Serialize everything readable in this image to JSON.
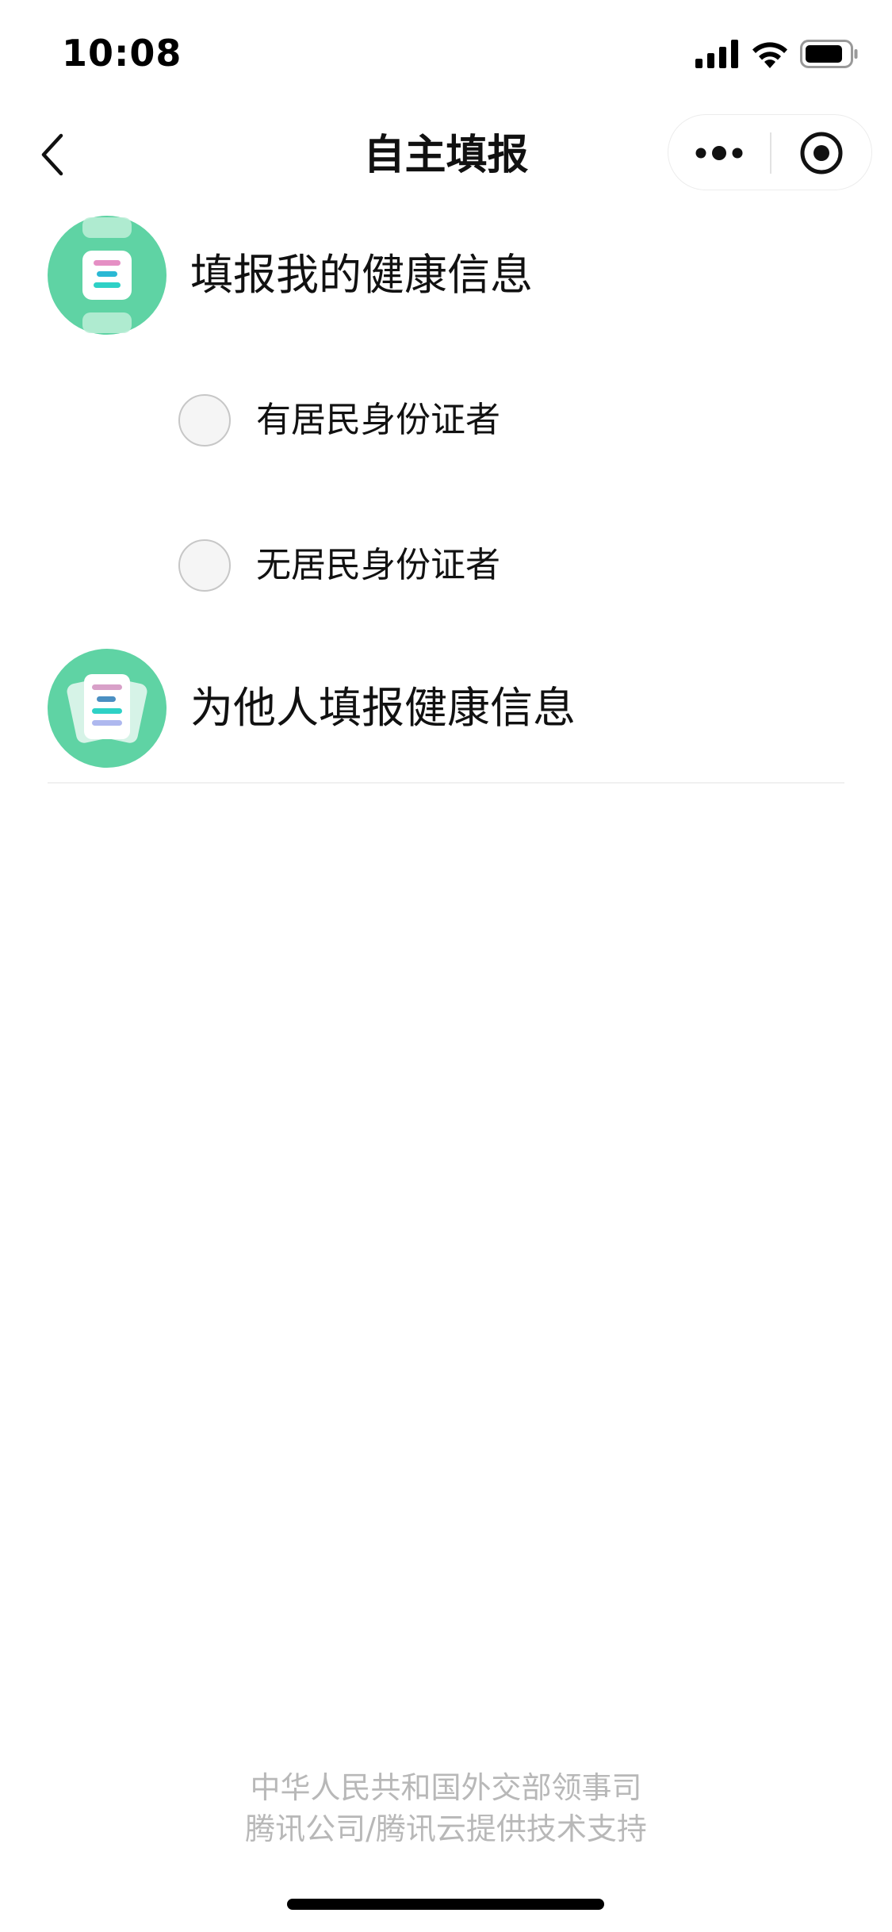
{
  "status_bar": {
    "time": "10:08",
    "icons": [
      "signal-icon",
      "wifi-icon",
      "battery-icon"
    ]
  },
  "nav": {
    "title": "自主填报",
    "back_icon": "chevron-left-icon",
    "more_icon": "more-dots-icon",
    "close_icon": "target-close-icon"
  },
  "sections": {
    "self": {
      "label": "填报我的健康信息",
      "icon": "health-card-icon",
      "options": [
        {
          "label": "有居民身份证者",
          "checked": false
        },
        {
          "label": "无居民身份证者",
          "checked": false
        }
      ]
    },
    "others": {
      "label": "为他人填报健康信息",
      "icon": "cards-stack-icon"
    }
  },
  "footer": {
    "line1": "中华人民共和国外交部领事司",
    "line2": "腾讯公司/腾讯云提供技术支持"
  },
  "colors": {
    "icon_green": "#5fd3a4",
    "footer_text": "#b8b8b8",
    "radio_border": "#c7c7c7"
  }
}
